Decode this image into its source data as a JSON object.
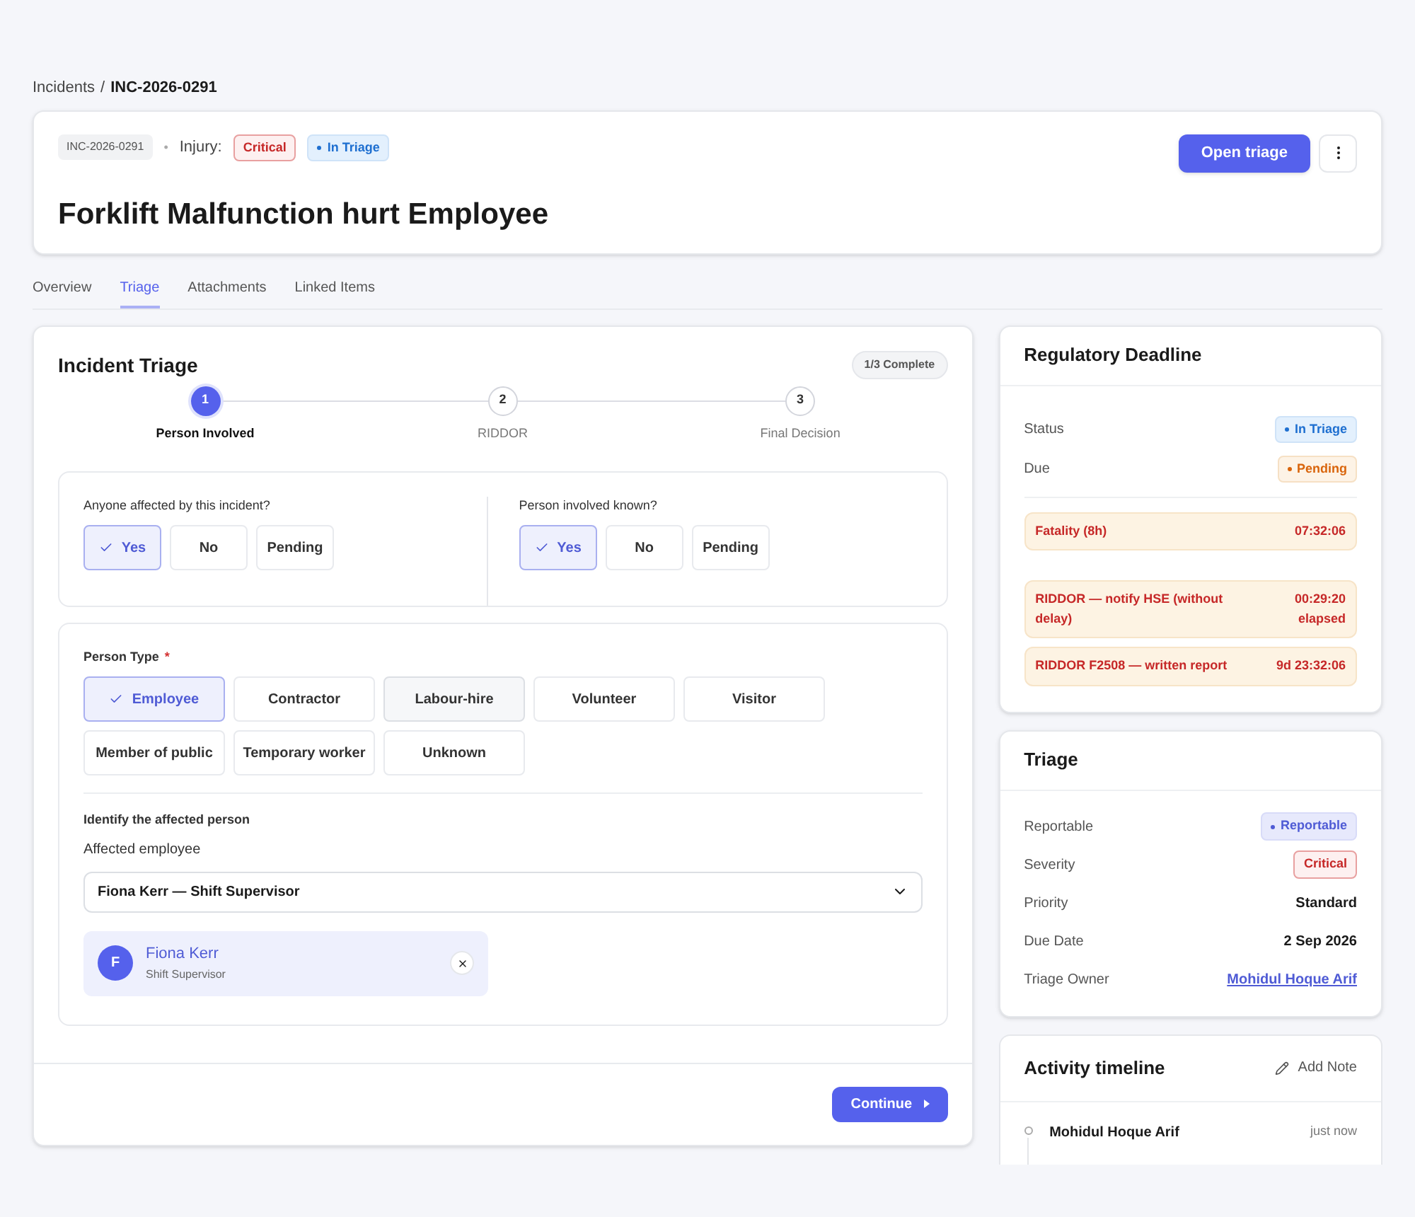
{
  "breadcrumb": {
    "parent": "Incidents",
    "separator": "/",
    "current": "INC-2026-0291"
  },
  "header": {
    "id": "INC-2026-0291",
    "separator": "•",
    "category_label": "Injury:",
    "badges": [
      {
        "label": "Critical",
        "kind": "critical"
      },
      {
        "label": "In Triage",
        "kind": "info"
      }
    ],
    "title": "Forklift Malfunction hurt Employee",
    "primary_action": "Open triage"
  },
  "tabs": [
    {
      "label": "Overview",
      "selected": false
    },
    {
      "label": "Triage",
      "selected": true
    },
    {
      "label": "Attachments",
      "selected": false
    },
    {
      "label": "Linked Items",
      "selected": false
    }
  ],
  "triage_panel": {
    "title": "Incident Triage",
    "progress": "1/3 Complete",
    "steps": [
      {
        "number": "1",
        "label": "Person Involved",
        "selected": true
      },
      {
        "number": "2",
        "label": "RIDDOR",
        "selected": false
      },
      {
        "number": "3",
        "label": "Final Decision",
        "selected": false
      }
    ],
    "questions": [
      {
        "label": "Anyone affected by this incident?",
        "options": [
          {
            "label": "Yes",
            "selected": true
          },
          {
            "label": "No",
            "selected": false
          },
          {
            "label": "Pending",
            "selected": false
          }
        ]
      },
      {
        "label": "Person involved known?",
        "options": [
          {
            "label": "Yes",
            "selected": true
          },
          {
            "label": "No",
            "selected": false
          },
          {
            "label": "Pending",
            "selected": false
          }
        ]
      }
    ],
    "person_type": {
      "label": "Person Type",
      "required_mark": "*",
      "options": [
        {
          "label": "Employee",
          "selected": true,
          "highlighted": false
        },
        {
          "label": "Contractor",
          "selected": false,
          "highlighted": false
        },
        {
          "label": "Labour-hire",
          "selected": false,
          "highlighted": true
        },
        {
          "label": "Volunteer",
          "selected": false,
          "highlighted": false
        },
        {
          "label": "Visitor",
          "selected": false,
          "highlighted": false
        },
        {
          "label": "Member of public",
          "selected": false,
          "highlighted": false
        },
        {
          "label": "Temporary worker",
          "selected": false,
          "highlighted": false
        },
        {
          "label": "Unknown",
          "selected": false,
          "highlighted": false
        }
      ]
    },
    "identify": {
      "heading": "Identify the affected person",
      "field_label": "Affected employee",
      "value": "Fiona Kerr — Shift Supervisor",
      "person": {
        "initial": "F",
        "name": "Fiona Kerr",
        "role": "Shift Supervisor"
      }
    },
    "continue_button": "Continue"
  },
  "regulatory_deadline": {
    "title": "Regulatory Deadline",
    "fields": [
      {
        "label": "Status",
        "badge": {
          "label": "In Triage",
          "kind": "info"
        }
      },
      {
        "label": "Due",
        "badge": {
          "label": "Pending",
          "kind": "warning"
        }
      }
    ],
    "timer_groups": [
      {
        "timers": [
          {
            "label": "Fatality (8h)",
            "value": "07:32:06"
          }
        ]
      },
      {
        "timers": [
          {
            "label": "RIDDOR — notify HSE (without delay)",
            "value": "00:29:20 elapsed"
          },
          {
            "label": "RIDDOR F2508 — written report",
            "value": "9d 23:32:06"
          }
        ]
      }
    ]
  },
  "triage_summary": {
    "title": "Triage",
    "rows": [
      {
        "label": "Reportable",
        "kind": "badge",
        "badge": {
          "label": "Reportable",
          "kind": "accent"
        }
      },
      {
        "label": "Severity",
        "kind": "badge",
        "badge": {
          "label": "Critical",
          "kind": "critical"
        }
      },
      {
        "label": "Priority",
        "kind": "text",
        "value": "Standard"
      },
      {
        "label": "Due Date",
        "kind": "text",
        "value": "2 Sep 2026"
      },
      {
        "label": "Triage Owner",
        "kind": "link",
        "value": "Mohidul Hoque Arif"
      }
    ]
  },
  "activity_timeline": {
    "title": "Activity timeline",
    "action": "Add Note",
    "entries": [
      {
        "author": "Mohidul Hoque Arif",
        "time": "just now"
      }
    ]
  }
}
